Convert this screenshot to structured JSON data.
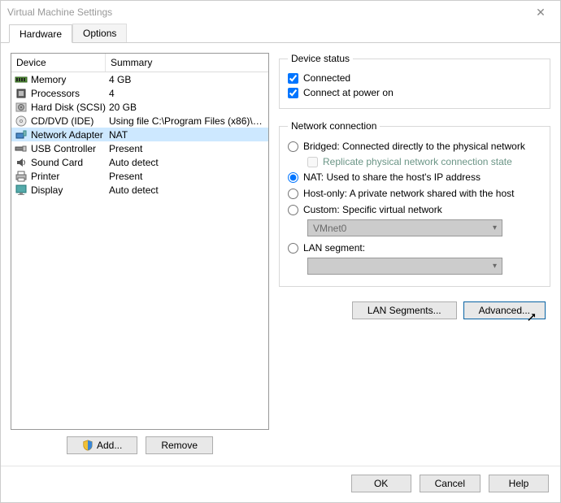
{
  "window": {
    "title": "Virtual Machine Settings"
  },
  "tabs": {
    "hardware": "Hardware",
    "options": "Options"
  },
  "headers": {
    "device": "Device",
    "summary": "Summary"
  },
  "devices": [
    {
      "name": "Memory",
      "summary": "4 GB",
      "icon": "memory"
    },
    {
      "name": "Processors",
      "summary": "4",
      "icon": "cpu"
    },
    {
      "name": "Hard Disk (SCSI)",
      "summary": "20 GB",
      "icon": "disk"
    },
    {
      "name": "CD/DVD (IDE)",
      "summary": "Using file C:\\Program Files (x86)\\VM...",
      "icon": "cd"
    },
    {
      "name": "Network Adapter",
      "summary": "NAT",
      "icon": "net",
      "selected": true
    },
    {
      "name": "USB Controller",
      "summary": "Present",
      "icon": "usb"
    },
    {
      "name": "Sound Card",
      "summary": "Auto detect",
      "icon": "sound"
    },
    {
      "name": "Printer",
      "summary": "Present",
      "icon": "printer"
    },
    {
      "name": "Display",
      "summary": "Auto detect",
      "icon": "display"
    }
  ],
  "left_buttons": {
    "add": "Add...",
    "remove": "Remove"
  },
  "device_status": {
    "legend": "Device status",
    "connected": "Connected",
    "connect_poweron": "Connect at power on"
  },
  "net_conn": {
    "legend": "Network connection",
    "bridged": "Bridged: Connected directly to the physical network",
    "replicate": "Replicate physical network connection state",
    "nat": "NAT: Used to share the host's IP address",
    "hostonly": "Host-only: A private network shared with the host",
    "custom": "Custom: Specific virtual network",
    "custom_value": "VMnet0",
    "lanseg": "LAN segment:"
  },
  "right_buttons": {
    "lansegments": "LAN Segments...",
    "advanced": "Advanced..."
  },
  "footer": {
    "ok": "OK",
    "cancel": "Cancel",
    "help": "Help"
  }
}
